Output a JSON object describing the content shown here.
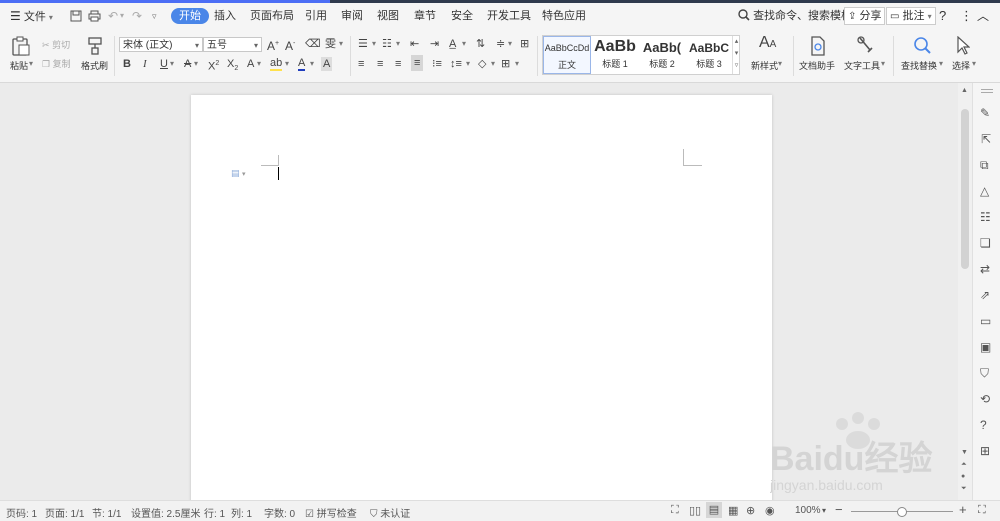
{
  "menu": {
    "file_label": "文件",
    "tabs": [
      "开始",
      "插入",
      "页面布局",
      "引用",
      "审阅",
      "视图",
      "章节",
      "安全",
      "开发工具",
      "特色应用"
    ],
    "search_label": "查找命令、搜索模板",
    "share_label": "分享",
    "comment_label": "批注",
    "help_label": "?"
  },
  "ribbon": {
    "paste": "粘贴",
    "cut": "剪切",
    "copy": "复制",
    "format_painter": "格式刷",
    "font_name": "宋体 (正文)",
    "font_size": "五号",
    "styles": [
      {
        "sample": "AaBbCcDd",
        "name": "正文"
      },
      {
        "sample": "AaBb",
        "name": "标题 1"
      },
      {
        "sample": "AaBb(",
        "name": "标题 2"
      },
      {
        "sample": "AaBbC",
        "name": "标题 3"
      }
    ],
    "new_style": "新样式",
    "doc_assistant": "文档助手",
    "text_tools": "文字工具",
    "find_replace": "查找替换",
    "select": "选择"
  },
  "status": {
    "page_num": "页码: 1",
    "pages": "页面: 1/1",
    "section": "节: 1/1",
    "setting": "设置值: 2.5厘米",
    "row": "行: 1",
    "col": "列: 1",
    "words": "字数: 0",
    "spell": "拼写检查",
    "auth": "未认证",
    "zoom": "100%"
  },
  "watermark": {
    "brand": "Baidu经验",
    "url": "jingyan.baidu.com"
  },
  "colors": {
    "accent": "#4a86e8",
    "font_color": "#1f3dbd",
    "highlight": "#ffe14d"
  }
}
